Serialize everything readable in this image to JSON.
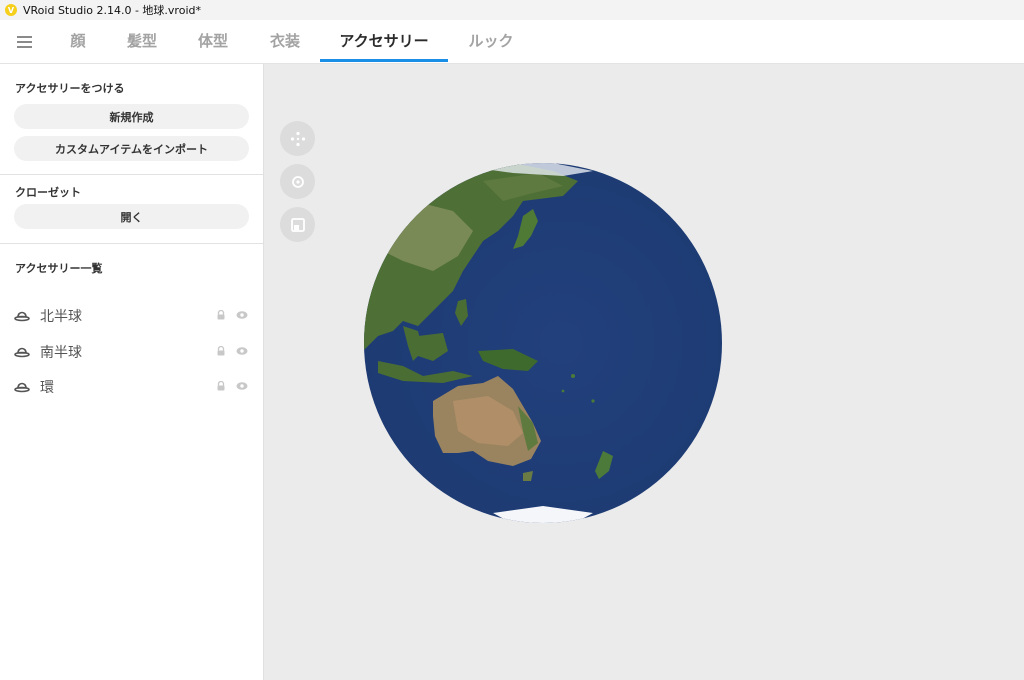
{
  "window": {
    "title": "VRoid Studio 2.14.0 - 地球.vroid*"
  },
  "nav": {
    "tabs": [
      {
        "label": "顔"
      },
      {
        "label": "髪型"
      },
      {
        "label": "体型"
      },
      {
        "label": "衣装"
      },
      {
        "label": "アクセサリー"
      },
      {
        "label": "ルック"
      }
    ],
    "active_tab": "アクセサリー",
    "accent_color": "#1a8fe8"
  },
  "sidebar": {
    "attach_section": {
      "title": "アクセサリーをつける",
      "new_button": "新規作成",
      "import_button": "カスタムアイテムをインポート"
    },
    "closet_section": {
      "title": "クローゼット",
      "open_button": "開く"
    },
    "list_section": {
      "title": "アクセサリー一覧",
      "items": [
        {
          "label": "北半球",
          "icon": "hat-icon"
        },
        {
          "label": "南半球",
          "icon": "hat-icon"
        },
        {
          "label": "環",
          "icon": "hat-icon"
        }
      ]
    }
  },
  "viewport": {
    "tools": [
      "move-icon",
      "rotate-icon",
      "frame-icon"
    ],
    "model": "earth-globe"
  }
}
